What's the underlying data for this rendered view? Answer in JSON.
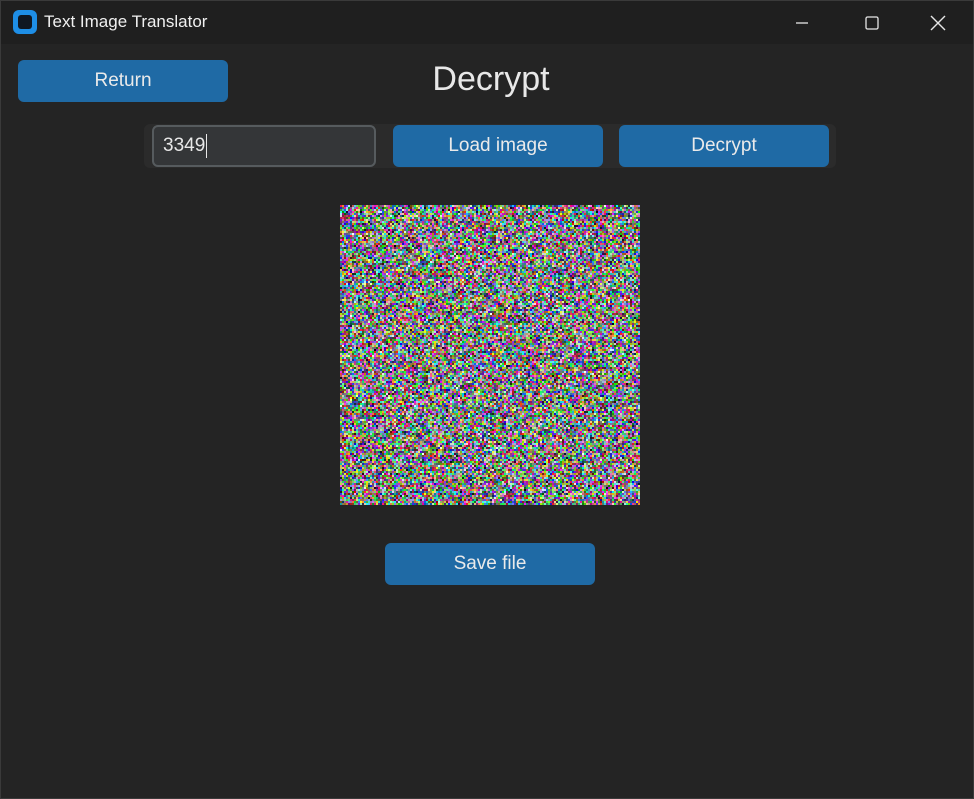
{
  "window": {
    "title": "Text Image Translator",
    "icon": "app-logo-icon",
    "controls": {
      "minimize": "minimize-icon",
      "maximize": "maximize-icon",
      "close": "close-icon"
    }
  },
  "header": {
    "return_label": "Return",
    "title": "Decrypt"
  },
  "toolbar": {
    "key_value": "3349",
    "load_label": "Load image",
    "decrypt_label": "Decrypt"
  },
  "preview": {
    "description": "noise-image"
  },
  "footer": {
    "save_label": "Save file"
  },
  "colors": {
    "accent": "#1f6aa5",
    "background": "#242424",
    "titlebar": "#1f1f1f"
  }
}
